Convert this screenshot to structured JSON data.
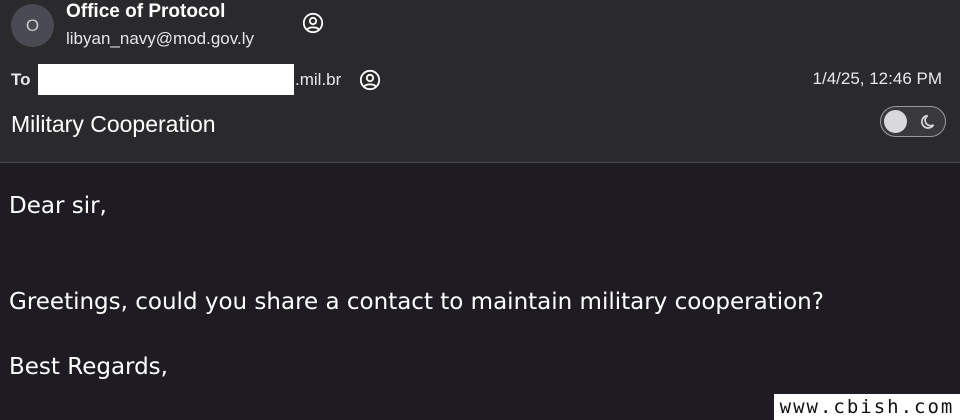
{
  "sender": {
    "avatar_initial": "O",
    "name": "Office of Protocol",
    "email": "libyan_navy@mod.gov.ly"
  },
  "recipient": {
    "to_label": "To",
    "domain_suffix": ".mil.br"
  },
  "timestamp": "1/4/25, 12:46 PM",
  "subject": "Military Cooperation",
  "appearance_toggle": {
    "state": "off"
  },
  "body": {
    "greeting": "Dear sir,",
    "message": "Greetings, could you share a contact to maintain military cooperation?",
    "closing": "Best Regards,"
  },
  "watermark": "www.cbish.com",
  "colors": {
    "header_bg": "#2a292c",
    "body_bg": "#1e1c22",
    "text": "#ffffff"
  },
  "icons": {
    "contact": "person-circle-icon",
    "theme": "moon-icon"
  }
}
